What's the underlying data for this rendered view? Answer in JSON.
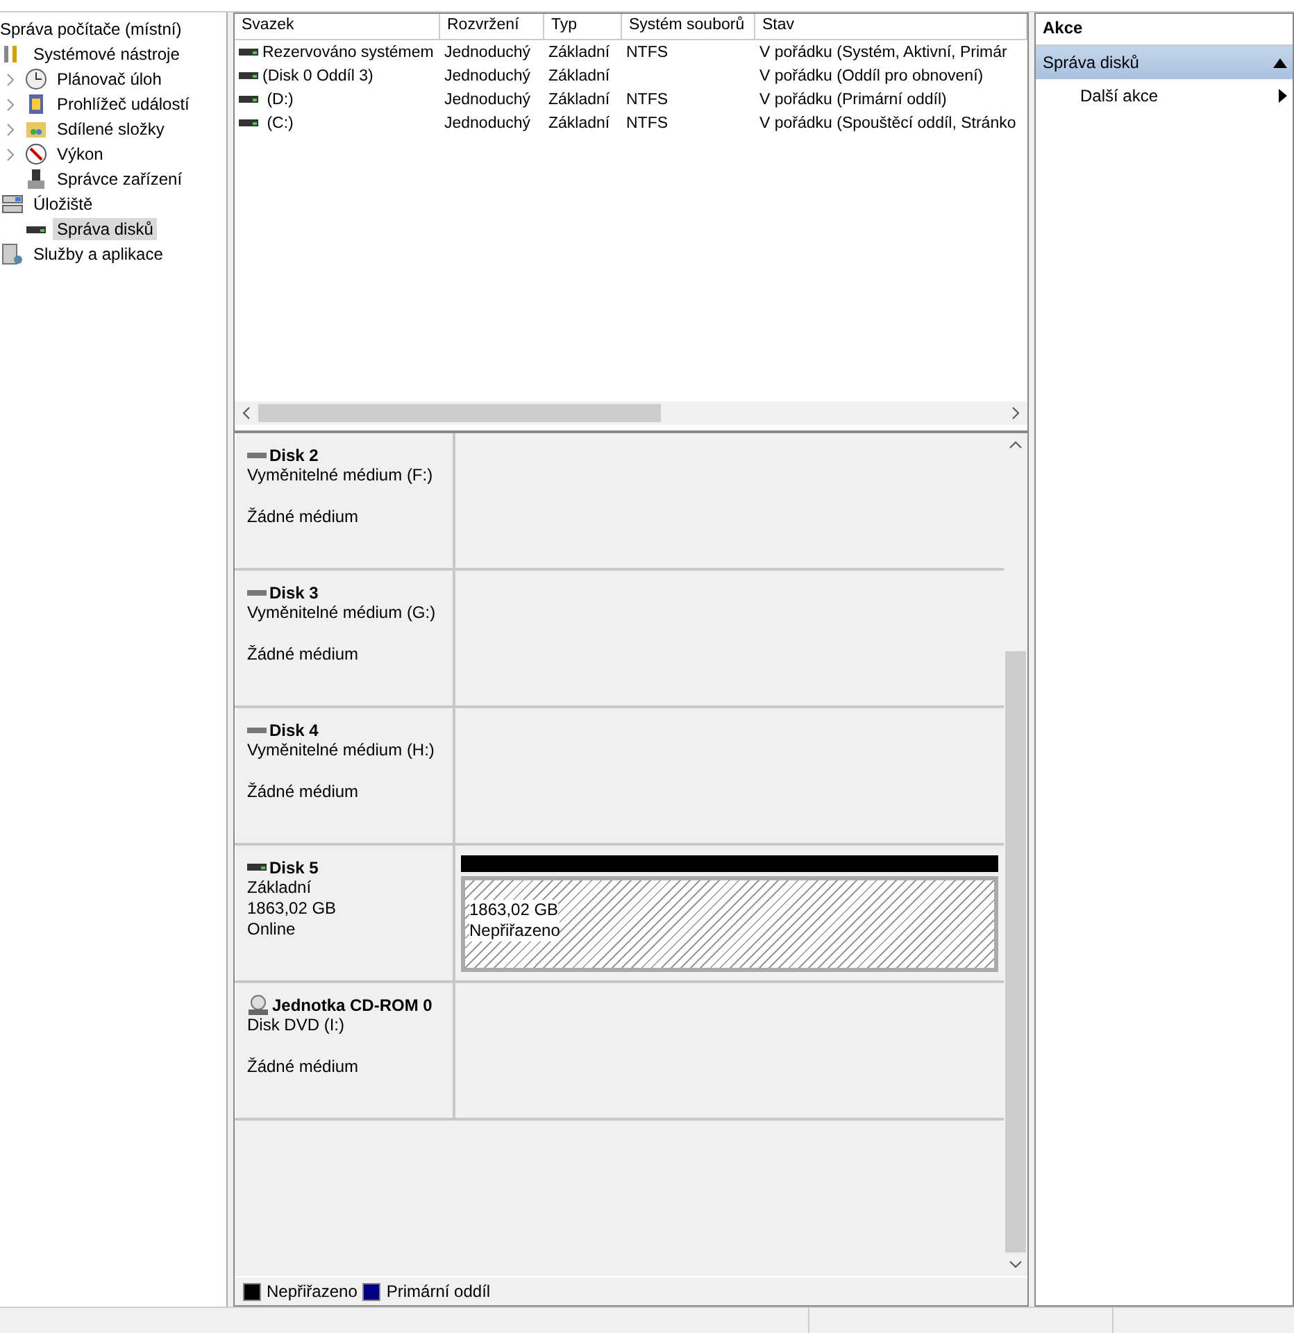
{
  "tree": {
    "label": "Správa počítače (místní)",
    "children": [
      {
        "label": "Systémové nástroje",
        "selected": false,
        "children": [
          {
            "label": "Plánovač úloh",
            "expanded": false,
            "selected": false
          },
          {
            "label": "Prohlížeč událostí",
            "expanded": false,
            "selected": false
          },
          {
            "label": "Sdílené složky",
            "expanded": false,
            "selected": false
          },
          {
            "label": "Výkon",
            "expanded": false,
            "selected": false
          },
          {
            "label": "Správce zařízení",
            "selected": false
          }
        ]
      },
      {
        "label": "Úložiště",
        "selected": false,
        "children": [
          {
            "label": "Správa disků",
            "selected": true
          }
        ]
      },
      {
        "label": "Služby a aplikace",
        "selected": false
      }
    ]
  },
  "volumes": {
    "columns": [
      "Svazek",
      "Rozvržení",
      "Typ",
      "Systém souborů",
      "Stav"
    ],
    "rows": [
      [
        "Rezervováno systémem",
        "Jednoduchý",
        "Základní",
        "NTFS",
        "V pořádku (Systém, Aktivní, Primár"
      ],
      [
        "(Disk 0 Oddíl 3)",
        "Jednoduchý",
        "Základní",
        null,
        "V pořádku (Oddíl pro obnovení)"
      ],
      [
        " (D:)",
        "Jednoduchý",
        "Základní",
        "NTFS",
        "V pořádku (Primární oddíl)"
      ],
      [
        " (C:)",
        "Jednoduchý",
        "Základní",
        "NTFS",
        "V pořádku (Spouštěcí oddíl, Stránko"
      ]
    ]
  },
  "disks": [
    {
      "kind": "removable",
      "name": "Disk 2",
      "lines": [
        "Vyměnitelné médium (F:)",
        "Žádné médium"
      ]
    },
    {
      "kind": "removable",
      "name": "Disk 3",
      "lines": [
        "Vyměnitelné médium (G:)",
        "Žádné médium"
      ]
    },
    {
      "kind": "removable",
      "name": "Disk 4",
      "lines": [
        "Vyměnitelné médium (H:)",
        "Žádné médium"
      ]
    },
    {
      "kind": "basic",
      "name": "Disk 5",
      "lines": [
        "Základní",
        "1863,02 GB",
        "Online"
      ],
      "partitions": [
        {
          "kind": "unallocated",
          "color": "#000000",
          "size": "1863,02 GB",
          "status": "Nepřiřazeno"
        }
      ]
    },
    {
      "kind": "cdrom",
      "name": "Jednotka CD-ROM 0",
      "lines": [
        "Disk DVD (I:)",
        "Žádné médium"
      ]
    }
  ],
  "legend": [
    {
      "label": "Nepřiřazeno",
      "color": "#000000"
    },
    {
      "label": "Primární oddíl",
      "color": "#000080"
    }
  ],
  "actions": {
    "title": "Akce",
    "section": {
      "label": "Správa disků",
      "expanded": true
    },
    "items": [
      {
        "label": "Další akce"
      }
    ]
  }
}
